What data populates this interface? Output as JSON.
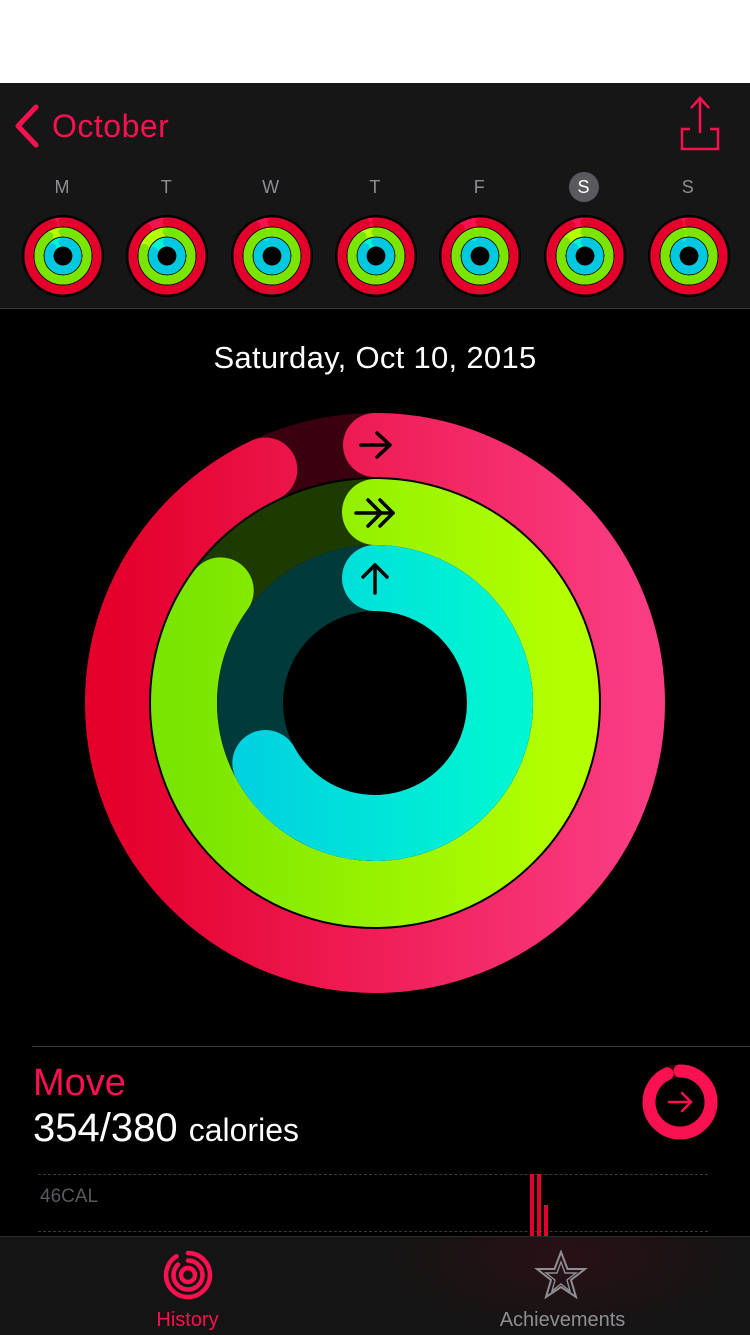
{
  "header": {
    "back_label": "October",
    "week": [
      {
        "letter": "M",
        "selected": false,
        "move": 0.95,
        "exercise": 0.9,
        "stand": 0.85
      },
      {
        "letter": "T",
        "selected": false,
        "move": 0.9,
        "exercise": 0.8,
        "stand": 0.8
      },
      {
        "letter": "W",
        "selected": false,
        "move": 0.92,
        "exercise": 0.95,
        "stand": 0.9
      },
      {
        "letter": "T",
        "selected": false,
        "move": 0.95,
        "exercise": 0.9,
        "stand": 0.85
      },
      {
        "letter": "F",
        "selected": false,
        "move": 0.9,
        "exercise": 0.95,
        "stand": 0.9
      },
      {
        "letter": "S",
        "selected": true,
        "move": 0.93,
        "exercise": 0.85,
        "stand": 0.85
      },
      {
        "letter": "S",
        "selected": false,
        "move": 0.95,
        "exercise": 0.95,
        "stand": 0.9
      }
    ]
  },
  "date_label": "Saturday, Oct 10, 2015",
  "rings": {
    "move": {
      "progress": 0.93,
      "color_start": "#e4002b",
      "color_end": "#fa3c82"
    },
    "exercise": {
      "progress": 0.85,
      "color_start": "#7ae500",
      "color_end": "#b4ff00"
    },
    "stand": {
      "progress": 0.67,
      "color_start": "#00d2e0",
      "color_end": "#00f5d2"
    }
  },
  "move": {
    "title": "Move",
    "value": "354/380",
    "unit": "calories",
    "progress": 0.93
  },
  "chart_data": {
    "type": "bar",
    "ylabel_tick": "46CAL",
    "bars": [
      {
        "position": 0.735,
        "value": 1.0
      },
      {
        "position": 0.745,
        "value": 1.0
      },
      {
        "position": 0.755,
        "value": 0.5
      }
    ]
  },
  "tabs": [
    {
      "label": "History",
      "active": true,
      "icon": "activity-rings-icon"
    },
    {
      "label": "Achievements",
      "active": false,
      "icon": "star-badge-icon"
    }
  ],
  "colors": {
    "accent": "#fa114f",
    "move": "#e4002b",
    "exercise": "#92e82a",
    "stand": "#00d8e8"
  }
}
